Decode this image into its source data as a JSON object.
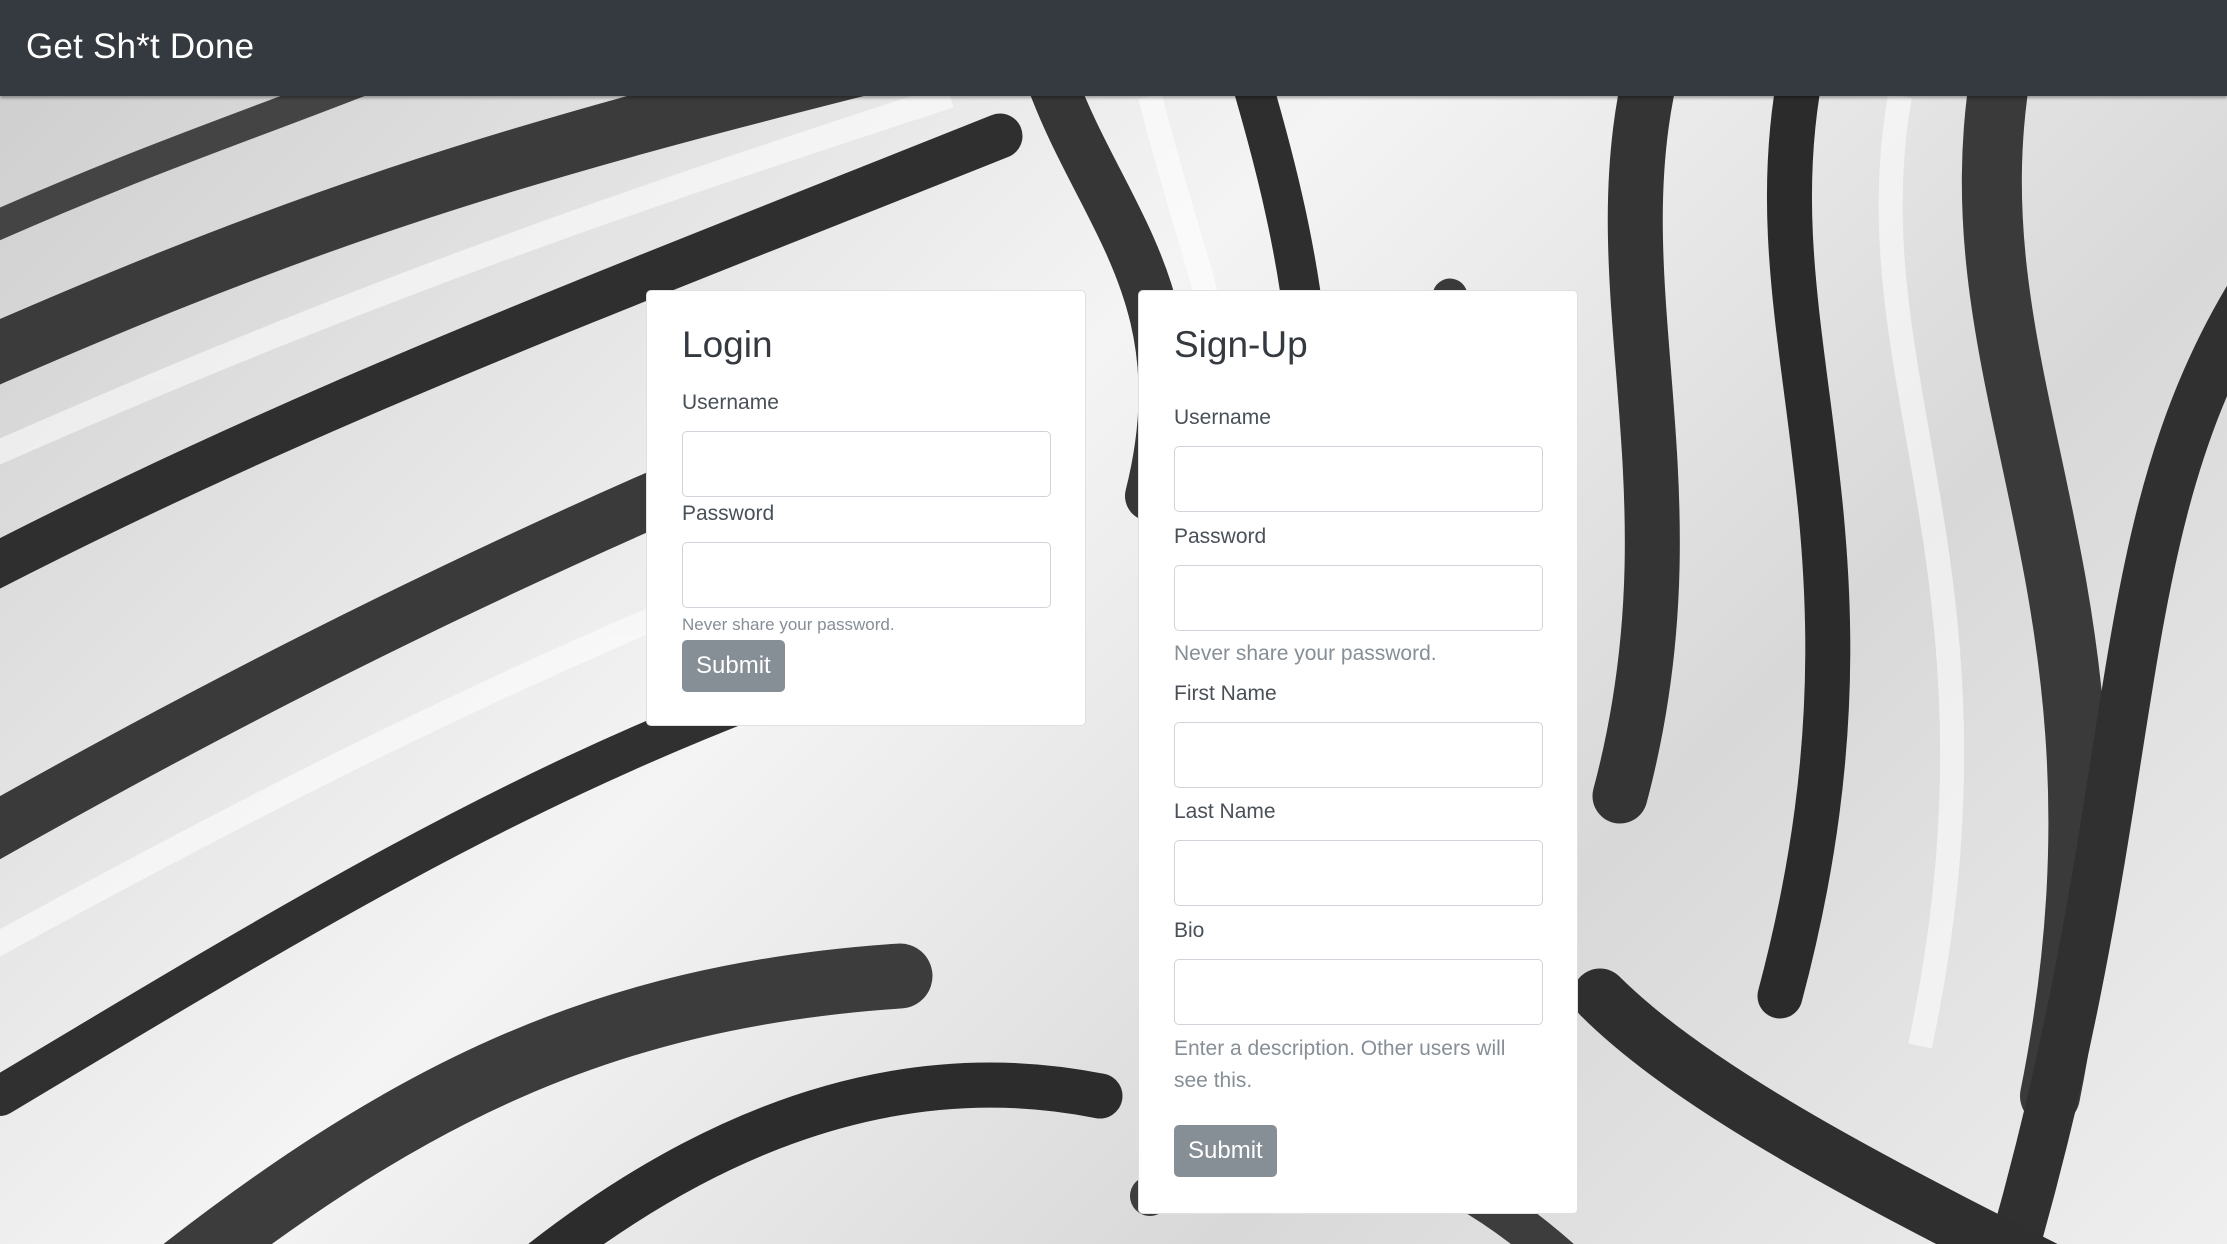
{
  "navbar": {
    "brand": "Get Sh*t Done"
  },
  "login": {
    "title": "Login",
    "username_label": "Username",
    "username_value": "",
    "password_label": "Password",
    "password_value": "",
    "password_help": "Never share your password.",
    "submit_label": "Submit"
  },
  "signup": {
    "title": "Sign-Up",
    "username_label": "Username",
    "username_value": "",
    "password_label": "Password",
    "password_value": "",
    "password_help": "Never share your password.",
    "first_name_label": "First Name",
    "first_name_value": "",
    "last_name_label": "Last Name",
    "last_name_value": "",
    "bio_label": "Bio",
    "bio_value": "",
    "bio_help": "Enter a description. Other users will see this.",
    "submit_label": "Submit"
  },
  "colors": {
    "navbar_bg": "#343a40",
    "button_bg": "#868e96",
    "card_bg": "#ffffff"
  }
}
